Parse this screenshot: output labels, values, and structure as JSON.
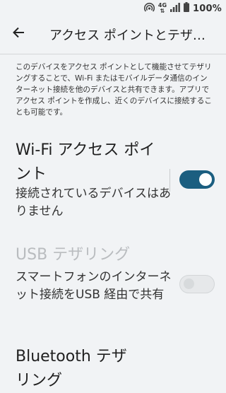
{
  "status_bar": {
    "network_type": "4G",
    "network_sub": "⇅",
    "battery": "100%"
  },
  "app_bar": {
    "title": "アクセス ポイントとテザリング"
  },
  "description": "このデバイスをアクセス ポイントとして機能させてテザリングすることで、Wi-Fi またはモバイルデータ通信のインターネット接続を他のデバイスと共有できます。アプリでアクセス ポイントを作成し、近くのデバイスに接続することも可能です。",
  "wifi_hotspot": {
    "title": "Wi-Fi アクセス ポイント",
    "summary": "接続されているデバイスはありません",
    "enabled": true
  },
  "usb_tethering": {
    "title": "USB テザリング",
    "summary": "スマートフォンのインターネット接続をUSB 経由で共有",
    "enabled": false
  },
  "bluetooth_tethering": {
    "title": "Bluetooth テザリング"
  },
  "colors": {
    "accent": "#1b5e80",
    "background": "#f1f3f5"
  }
}
